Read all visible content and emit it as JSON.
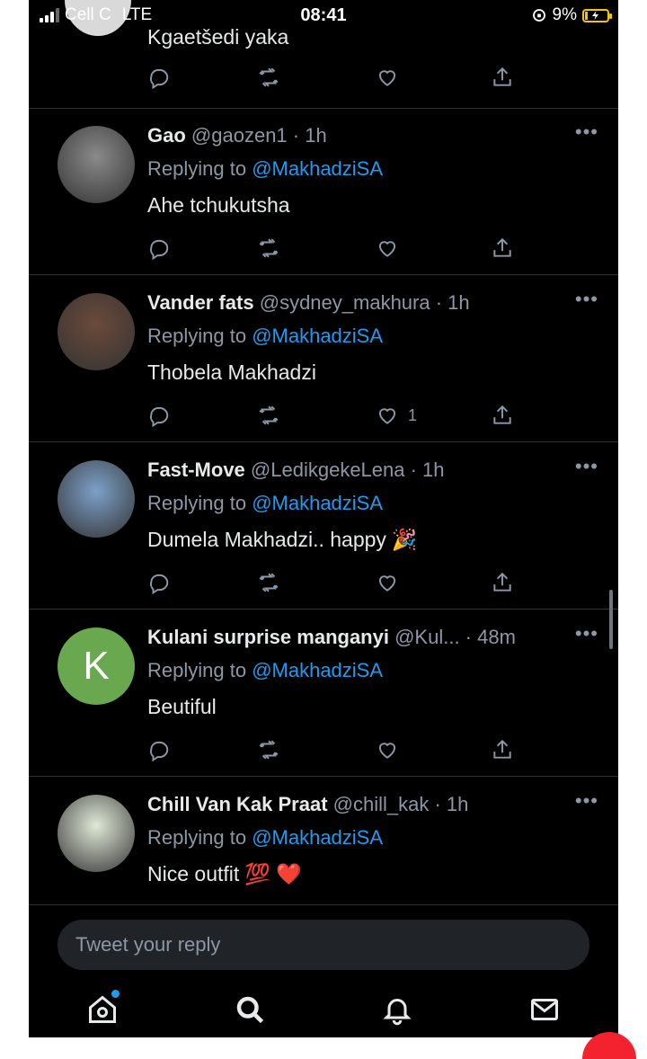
{
  "status_bar": {
    "carrier": "Cell C",
    "network": "LTE",
    "time": "08:41",
    "battery_percent": "9%",
    "battery_level": 0.09,
    "accent_color": "#f5c400"
  },
  "top_partial_tweet": {
    "text": "Kgaetšedi yaka"
  },
  "tweets": [
    {
      "name": "Gao",
      "handle": "@gaozen1 · 1h",
      "replying_prefix": "Replying to ",
      "replying_to": "@MakhadziSA",
      "text": "Ahe tchukutsha",
      "emoji": "",
      "likes": "",
      "avatar_color": "#8a8a8a"
    },
    {
      "name": "Vander fats",
      "handle": "@sydney_makhura · 1h",
      "replying_prefix": "Replying to ",
      "replying_to": "@MakhadziSA",
      "text": "Thobela Makhadzi",
      "emoji": "",
      "likes": "1",
      "avatar_color": "#6b4a3a"
    },
    {
      "name": "Fast-Move",
      "handle": "@LedikgekeLena · 1h",
      "replying_prefix": "Replying to ",
      "replying_to": "@MakhadziSA",
      "text": "Dumela Makhadzi.. happy",
      "emoji": "🎉",
      "likes": "",
      "avatar_color": "#7da0c8"
    },
    {
      "name": "Kulani surprise manganyi",
      "handle": "@Kul... · 48m",
      "replying_prefix": "Replying to ",
      "replying_to": "@MakhadziSA",
      "text": "Beutiful",
      "emoji": "",
      "likes": "",
      "avatar_letter": "K",
      "avatar_color": "#6aa84f"
    },
    {
      "name": "Chill Van Kak Praat",
      "handle": "@chill_kak · 1h",
      "replying_prefix": "Replying to ",
      "replying_to": "@MakhadziSA",
      "text": "Nice outfit",
      "emoji": "💯 ❤️",
      "likes": "",
      "avatar_color": "#dfe9d7"
    }
  ],
  "reply_box": {
    "placeholder": "Tweet your reply"
  },
  "tab_bar": {
    "items": [
      "home-icon",
      "search-icon",
      "bell-icon",
      "mail-icon"
    ]
  },
  "colors": {
    "background": "#000000",
    "link": "#1d9bf0",
    "muted": "#8b98a5",
    "text": "#e7e9ea"
  }
}
